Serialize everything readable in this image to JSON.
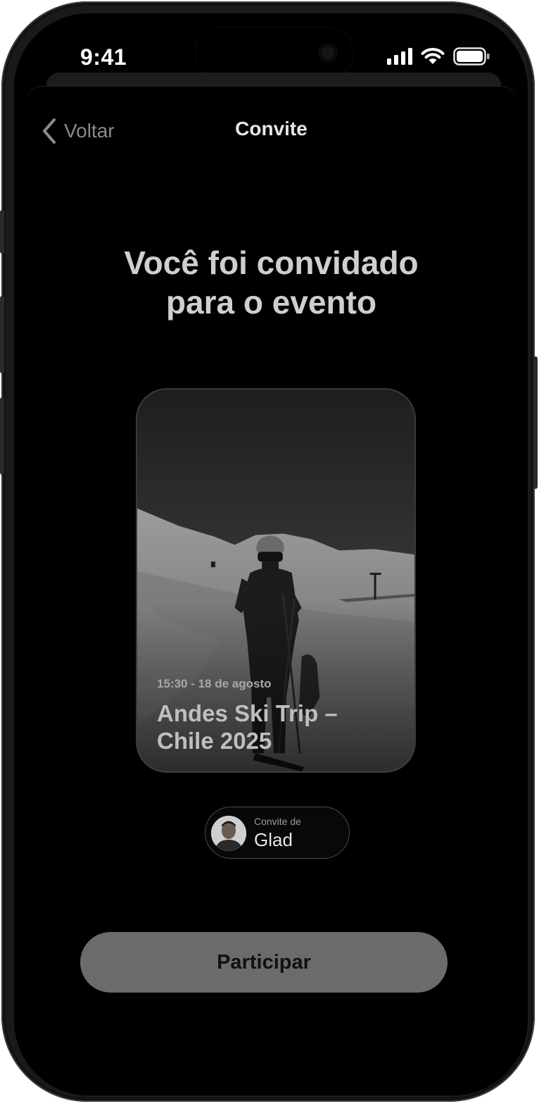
{
  "status_bar": {
    "time": "9:41"
  },
  "nav": {
    "back_label": "Voltar",
    "title": "Convite"
  },
  "headline": {
    "line1": "Você foi convidado",
    "line2": "para o evento"
  },
  "event": {
    "datetime": "15:30 - 18 de agosto",
    "name_line1": "Andes Ski Trip –",
    "name_line2": "Chile 2025"
  },
  "inviter": {
    "label": "Convite de",
    "name": "Glad"
  },
  "cta": {
    "label": "Participar"
  },
  "icons": {
    "back": "chevron-left-icon",
    "signal": "cellular-signal-icon",
    "wifi": "wifi-icon",
    "battery": "battery-icon"
  },
  "colors": {
    "background": "#000000",
    "primary_text": "#cfcfcf",
    "secondary_text": "#8a8a8a",
    "cta_background": "#6b6b6b",
    "cta_text": "#111111"
  }
}
